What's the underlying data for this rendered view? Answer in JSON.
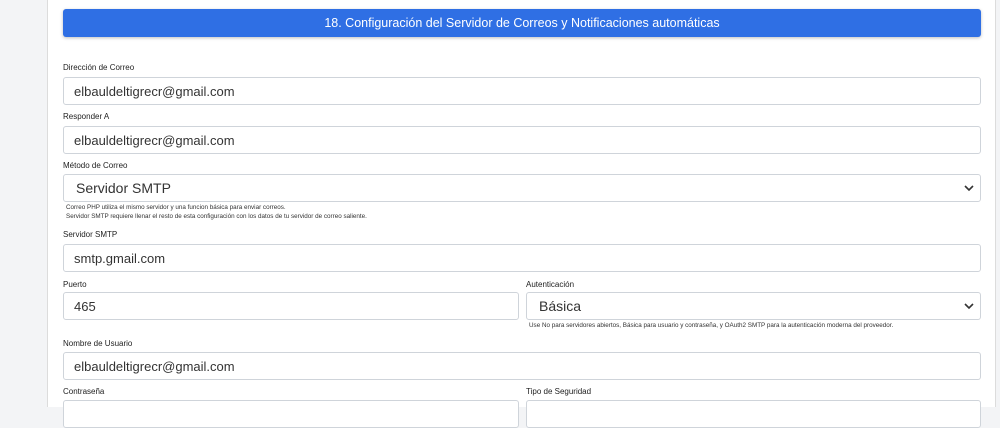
{
  "section": {
    "title": "18. Configuración del Servidor de Correos y Notificaciones automáticas"
  },
  "fields": {
    "from_address": {
      "label": "Dirección de Correo",
      "value": "elbauldeltigrecr@gmail.com"
    },
    "reply_to": {
      "label": "Responder A",
      "value": "elbauldeltigrecr@gmail.com"
    },
    "mail_method": {
      "label": "Método de Correo",
      "value": "Servidor SMTP",
      "help_line1": "Correo PHP utiliza el mismo servidor y una funcion básica para enviar correos.",
      "help_line2": "Servidor SMTP requiere llenar el resto de esta configuración con los datos de tu servidor de correo saliente."
    },
    "smtp_server": {
      "label": "Servidor SMTP",
      "value": "smtp.gmail.com"
    },
    "port": {
      "label": "Puerto",
      "value": "465"
    },
    "authentication": {
      "label": "Autenticación",
      "value": "Básica",
      "help": "Use No para servidores abiertos, Básica para usuario y contraseña, y OAuth2 SMTP para la autenticación moderna del proveedor."
    },
    "username": {
      "label": "Nombre de Usuario",
      "value": "elbauldeltigrecr@gmail.com"
    },
    "password": {
      "label": "Contraseña"
    },
    "security_type": {
      "label": "Tipo de Seguridad"
    }
  },
  "icons": {
    "select_arrow": "chevron-down-icon"
  },
  "colors": {
    "header": "#2f6fe4"
  }
}
